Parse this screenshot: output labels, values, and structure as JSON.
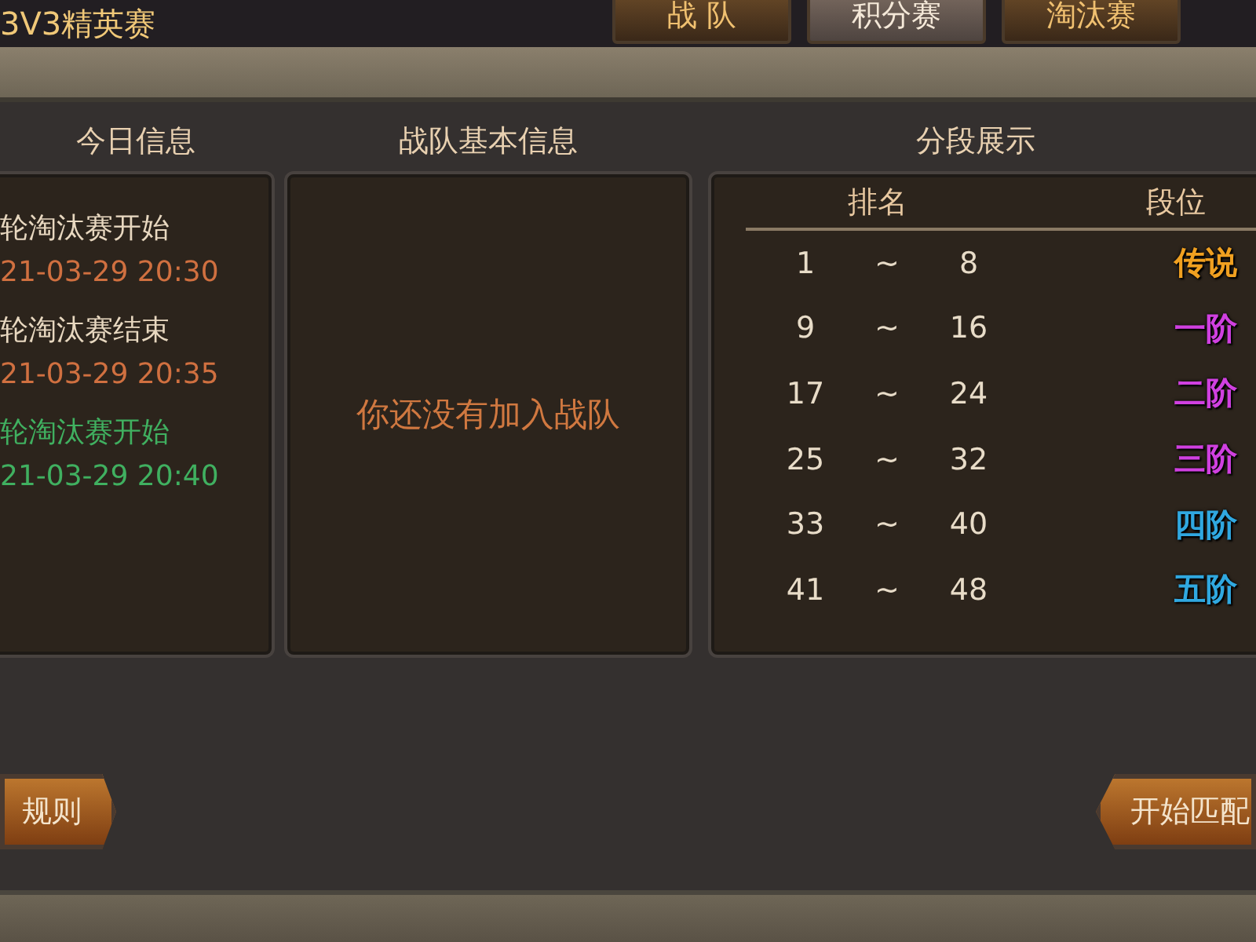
{
  "header": {
    "title": "3V3精英赛"
  },
  "tabs": [
    {
      "label": "战 队",
      "selected": false
    },
    {
      "label": "积分赛",
      "selected": true
    },
    {
      "label": "淘汰赛",
      "selected": false
    }
  ],
  "today": {
    "heading": "今日信息",
    "events": [
      {
        "title": "轮淘汰赛开始",
        "time": "21-03-29 20:30",
        "active": false
      },
      {
        "title": "轮淘汰赛结束",
        "time": "21-03-29 20:35",
        "active": false
      },
      {
        "title": "轮淘汰赛开始",
        "time": "21-03-29 20:40",
        "active": true
      }
    ]
  },
  "team": {
    "heading": "战队基本信息",
    "message": "你还没有加入战队"
  },
  "tiers": {
    "heading": "分段展示",
    "columns": [
      "排名",
      "段位"
    ],
    "rows": [
      {
        "from": "1",
        "sep": "~",
        "to": "8",
        "tier": "传说",
        "color": "#f0a020"
      },
      {
        "from": "9",
        "sep": "~",
        "to": "16",
        "tier": "一阶",
        "color": "#d040e0"
      },
      {
        "from": "17",
        "sep": "~",
        "to": "24",
        "tier": "二阶",
        "color": "#d040e0"
      },
      {
        "from": "25",
        "sep": "~",
        "to": "32",
        "tier": "三阶",
        "color": "#d040e0"
      },
      {
        "from": "33",
        "sep": "~",
        "to": "40",
        "tier": "四阶",
        "color": "#30a8e0"
      },
      {
        "from": "41",
        "sep": "~",
        "to": "48",
        "tier": "五阶",
        "color": "#30a8e0"
      }
    ]
  },
  "buttons": [
    {
      "label": "规则",
      "kind": "left"
    },
    {
      "label": "开始匹配",
      "kind": "right"
    }
  ]
}
